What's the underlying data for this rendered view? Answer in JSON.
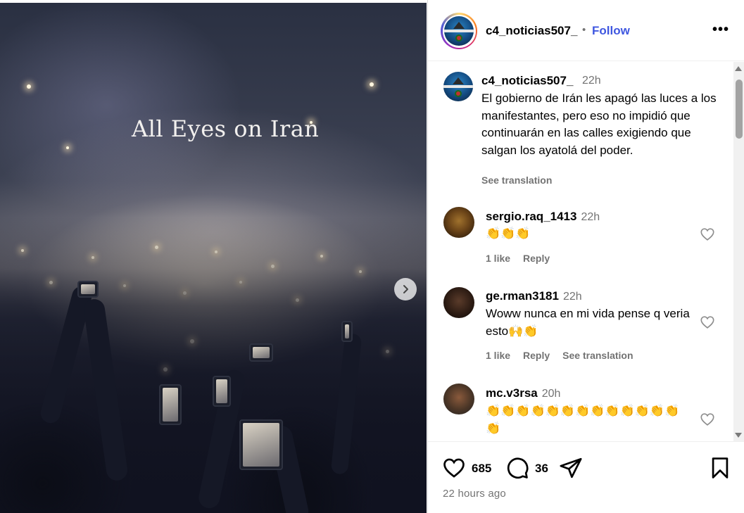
{
  "media": {
    "overlay_text": "All Eyes on Iran",
    "next_icon": "chevron-right-icon"
  },
  "header": {
    "username": "c4_noticias507_",
    "separator": "•",
    "follow_label": "Follow",
    "more_label": "•••"
  },
  "caption": {
    "username": "c4_noticias507_",
    "time": "22h",
    "text": "El gobierno de Irán les apagó las luces a los manifestantes, pero eso no impidió que continuarán en las calles exigiendo que salgan los ayatolá del poder.",
    "see_translation": "See translation"
  },
  "comments": [
    {
      "username": "sergio.raq_1413",
      "time": "22h",
      "text": "👏👏👏",
      "likes": "1 like",
      "reply": "Reply"
    },
    {
      "username": "ge.rman3181",
      "time": "22h",
      "text": "Woww nunca en mi vida pense q veria esto🙌👏",
      "likes": "1 like",
      "reply": "Reply",
      "see_translation": "See translation"
    },
    {
      "username": "mc.v3rsa",
      "time": "20h",
      "text": "👏👏👏👏👏👏👏👏👏👏👏👏👏👏"
    }
  ],
  "actions": {
    "like_count": "685",
    "comment_count": "36",
    "timestamp": "22 hours ago"
  }
}
